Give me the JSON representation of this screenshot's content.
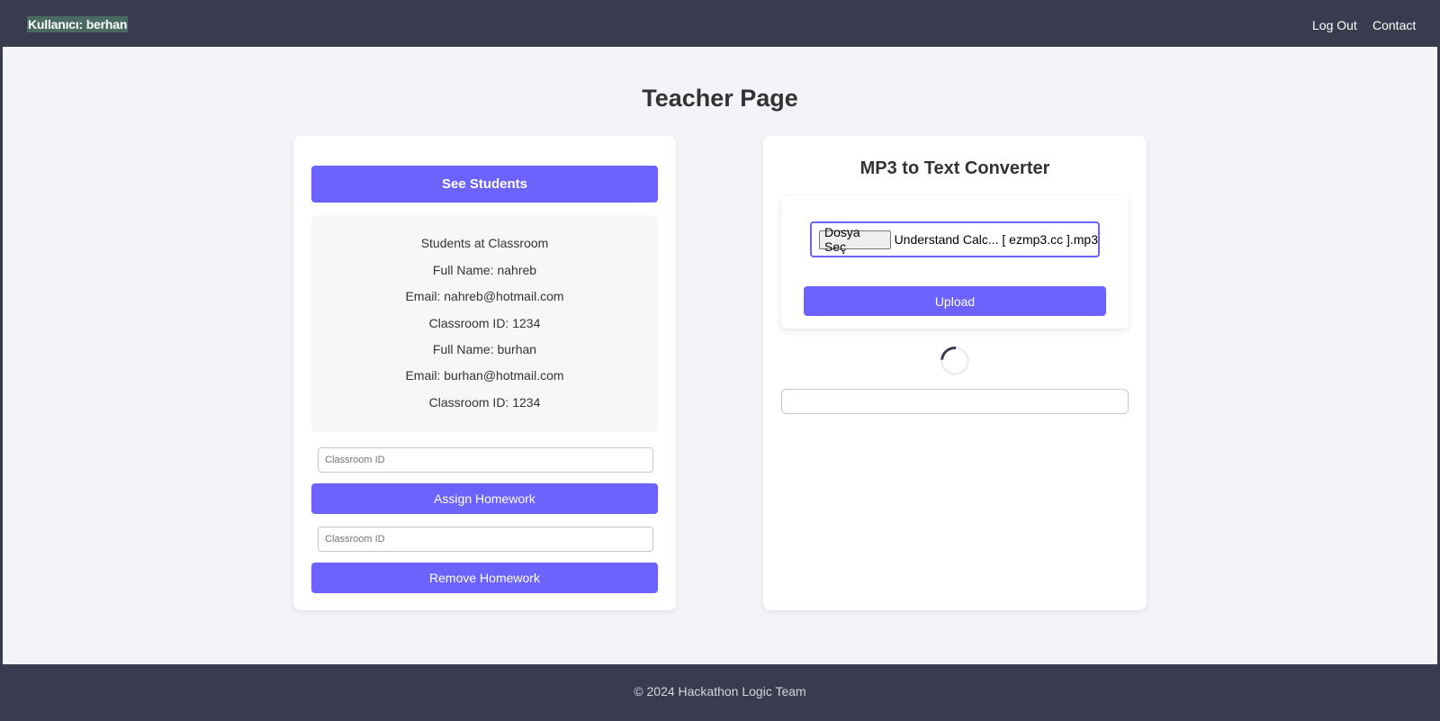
{
  "navbar": {
    "user_label": "Kullanıcı: berhan",
    "logout": "Log Out",
    "contact": "Contact"
  },
  "page": {
    "title": "Teacher Page"
  },
  "left_panel": {
    "see_students_button": "See Students",
    "students": {
      "heading": "Students at Classroom",
      "entries": [
        {
          "full_name": "Full Name: nahreb",
          "email": "Email: nahreb@hotmail.com",
          "classroom": "Classroom ID: 1234"
        },
        {
          "full_name": "Full Name: burhan",
          "email": "Email: burhan@hotmail.com",
          "classroom": "Classroom ID: 1234"
        }
      ]
    },
    "assign": {
      "placeholder": "Classroom ID",
      "button": "Assign Homework"
    },
    "remove": {
      "placeholder": "Classroom ID",
      "button": "Remove Homework"
    }
  },
  "right_panel": {
    "title": "MP3 to Text Converter",
    "file_button": "Dosya Seç",
    "file_name": "Understand Calc... [ ezmp3.cc ].mp3",
    "upload_button": "Upload",
    "result_text": ""
  },
  "footer": {
    "text": "© 2024 Hackathon Logic Team"
  },
  "colors": {
    "primary": "#6c63ff",
    "navbar": "#3b3b4f",
    "background": "#f4f4f8"
  }
}
